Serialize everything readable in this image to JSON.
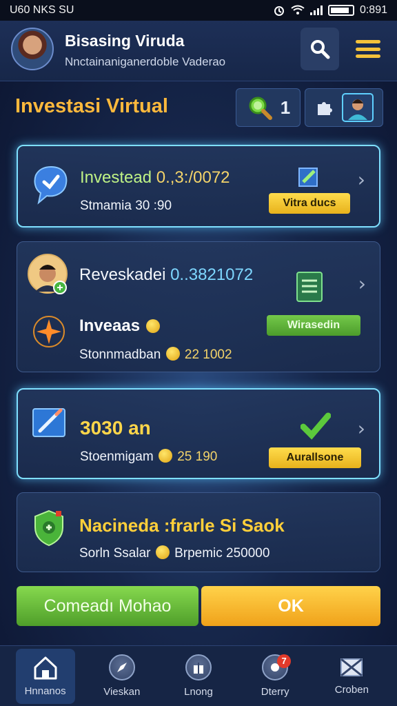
{
  "status_bar": {
    "left": "U60 NKS SU",
    "time": "0:891"
  },
  "header": {
    "title": "Bisasing Viruda",
    "subtitle": "Nnctainaniganerdoble Vaderao"
  },
  "section": {
    "title": "Investasi Virtual",
    "chip_count": "1"
  },
  "cards": [
    {
      "label": "Investead",
      "value": "0.,3:/0072",
      "sub": "Stmamia 30 :90",
      "button": "Vitra ducs"
    },
    {
      "label": "Reveskadei",
      "value": "0..3821072",
      "label2": "Inveaas",
      "sub": "Stonnmadban",
      "sub_value": "22 1002",
      "button": "Wirasedin"
    },
    {
      "value": "3030 an",
      "sub": "Stoenmigam",
      "sub_value": "25 190",
      "button": "Aurallsone"
    },
    {
      "label": "Nacineda :frarle Si Saok",
      "sub": "Sorln Ssalar",
      "sub_value": "Brpemic 250000"
    }
  ],
  "actions": {
    "primary": "Comeadı Mohao",
    "secondary": "OK"
  },
  "nav": [
    {
      "label": "Hnnanos",
      "icon": "home-icon"
    },
    {
      "label": "Vieskan",
      "icon": "compass-icon"
    },
    {
      "label": "Lnong",
      "icon": "gift-icon"
    },
    {
      "label": "Dterry",
      "icon": "notification-icon",
      "badge": "7"
    },
    {
      "label": "Croben",
      "icon": "mail-icon"
    }
  ],
  "colors": {
    "accent_gold": "#ffb93c",
    "accent_cyan": "#7fe0ff",
    "button_green": "#6cc23f",
    "button_yellow": "#f6b52c",
    "background": "#16264a"
  }
}
